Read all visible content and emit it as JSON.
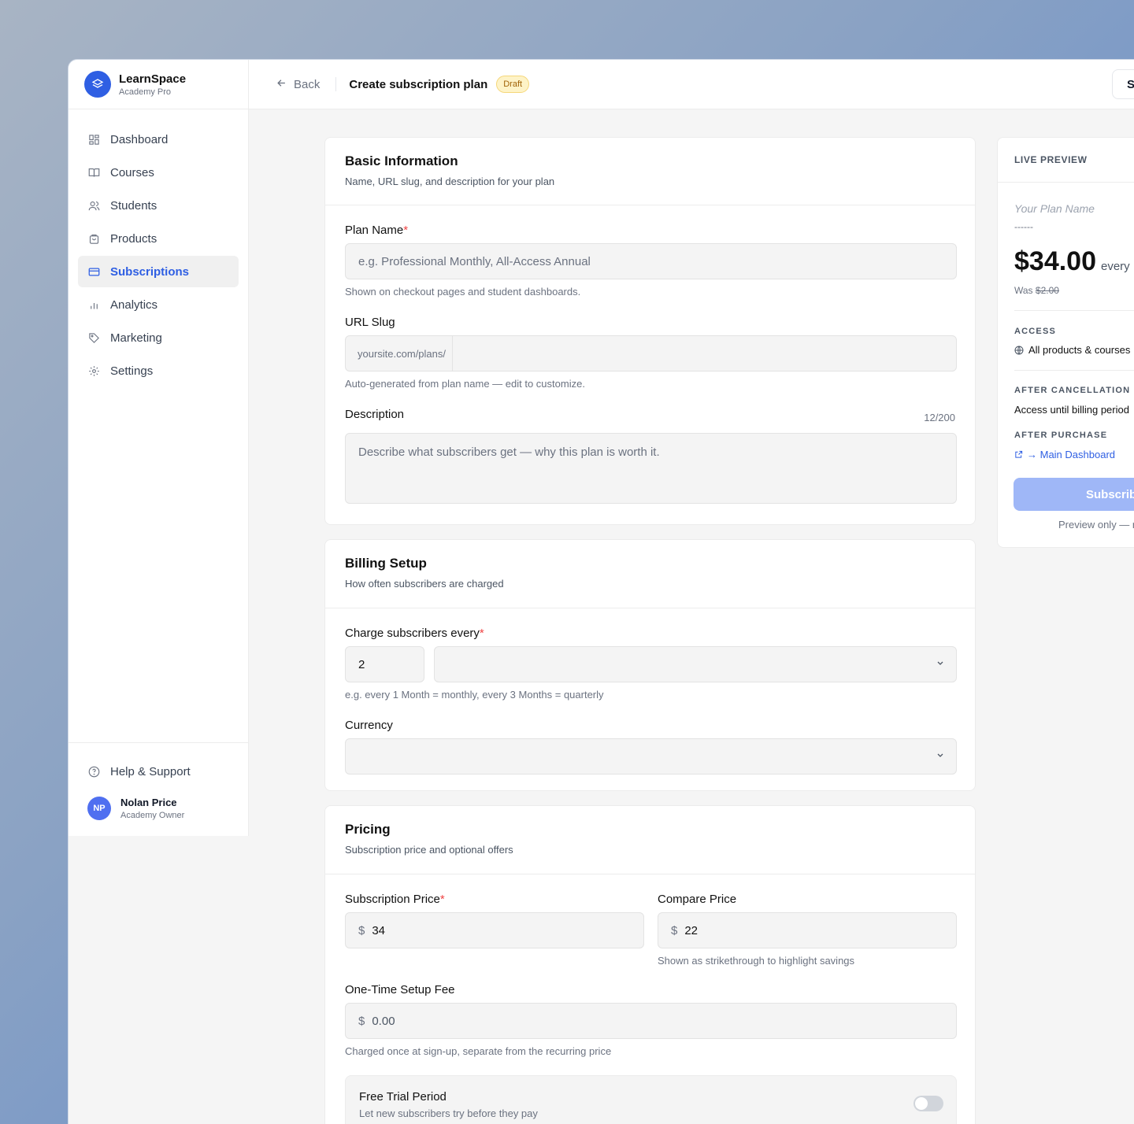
{
  "app": {
    "name": "LearnSpace",
    "subtitle": "Academy Pro"
  },
  "sidebar": {
    "items": [
      {
        "label": "Dashboard",
        "icon": "grid-icon"
      },
      {
        "label": "Courses",
        "icon": "book-icon"
      },
      {
        "label": "Students",
        "icon": "users-icon"
      },
      {
        "label": "Products",
        "icon": "bag-icon"
      },
      {
        "label": "Subscriptions",
        "icon": "card-icon",
        "active": true
      },
      {
        "label": "Analytics",
        "icon": "bar-chart-icon"
      },
      {
        "label": "Marketing",
        "icon": "tag-icon"
      },
      {
        "label": "Settings",
        "icon": "gear-icon"
      }
    ],
    "help": "Help & Support",
    "user": {
      "initials": "NP",
      "name": "Nolan Price",
      "role": "Academy Owner"
    }
  },
  "topbar": {
    "back": "Back",
    "title": "Create subscription plan",
    "badge": "Draft",
    "right_button": "S"
  },
  "basic": {
    "title": "Basic Information",
    "subtitle": "Name, URL slug, and description for your plan",
    "plan_name_label": "Plan Name",
    "plan_name_placeholder": "e.g. Professional Monthly, All-Access Annual",
    "plan_name_help": "Shown on checkout pages and student dashboards.",
    "slug_label": "URL Slug",
    "slug_prefix": "yoursite.com/plans/",
    "slug_help": "Auto-generated from plan name — edit to customize.",
    "desc_label": "Description",
    "desc_count": "12/200",
    "desc_placeholder": "Describe what subscribers get — why this plan is worth it."
  },
  "billing": {
    "title": "Billing Setup",
    "subtitle": "How often subscribers are charged",
    "charge_label": "Charge subscribers every",
    "interval_value": "2",
    "charge_help": "e.g. every 1 Month = monthly, every 3 Months = quarterly",
    "currency_label": "Currency"
  },
  "pricing": {
    "title": "Pricing",
    "subtitle": "Subscription price and optional offers",
    "price_label": "Subscription Price",
    "price_value": "34",
    "compare_label": "Compare Price",
    "compare_value": "22",
    "compare_help": "Shown as strikethrough to highlight savings",
    "setup_label": "One-Time Setup Fee",
    "setup_placeholder": "0.00",
    "setup_help": "Charged once at sign-up, separate from the recurring price",
    "currency_symbol": "$",
    "trial_title": "Free Trial Period",
    "trial_sub": "Let new subscribers try before they pay"
  },
  "preview": {
    "header": "LIVE PREVIEW",
    "name_placeholder": "Your Plan Name",
    "dashes": "------",
    "price": "$34.00",
    "every": "every",
    "was_label": "Was",
    "was_price": "$2.00",
    "access_cap": "ACCESS",
    "access_val": "All products & courses",
    "after_cancel_cap": "AFTER CANCELLATION",
    "after_cancel_val": "Access until billing period",
    "after_purchase_cap": "AFTER PURCHASE",
    "after_purchase_val": "→ Main Dashboard",
    "button": "Subscrib",
    "note": "Preview only — r"
  },
  "colors": {
    "accent": "#2f5fe3",
    "required": "#ef4444",
    "badge_bg": "#fef3c7"
  }
}
